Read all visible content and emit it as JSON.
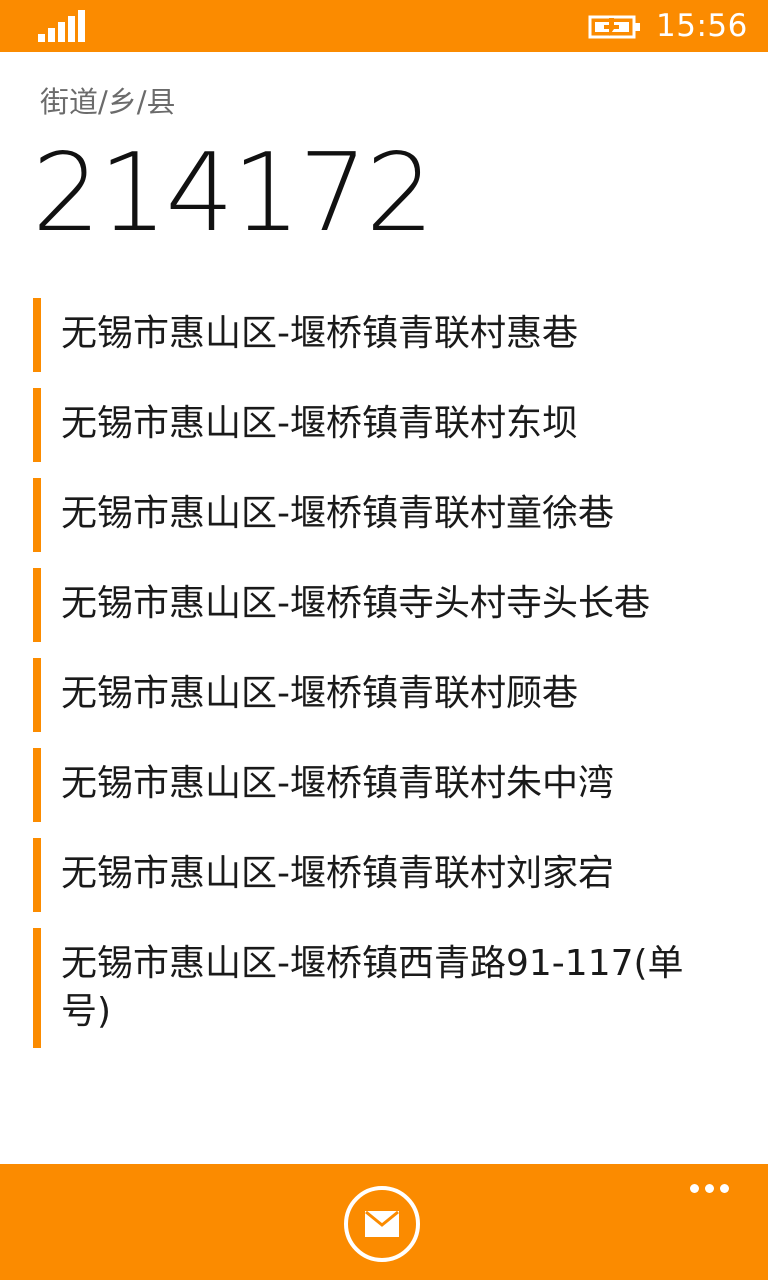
{
  "status_bar": {
    "time": "15:56",
    "signal_icon": "signal-bars-icon",
    "battery_icon": "battery-charging-icon"
  },
  "header": {
    "category": "街道/乡/县",
    "postcode": "214172"
  },
  "results": [
    {
      "label": "无锡市惠山区-堰桥镇青联村惠巷"
    },
    {
      "label": "无锡市惠山区-堰桥镇青联村东坝"
    },
    {
      "label": "无锡市惠山区-堰桥镇青联村童徐巷"
    },
    {
      "label": "无锡市惠山区-堰桥镇寺头村寺头长巷"
    },
    {
      "label": "无锡市惠山区-堰桥镇青联村顾巷"
    },
    {
      "label": "无锡市惠山区-堰桥镇青联村朱中湾"
    },
    {
      "label": "无锡市惠山区-堰桥镇青联村刘家宕"
    },
    {
      "label": "无锡市惠山区-堰桥镇西青路91-117(单号)"
    }
  ],
  "app_bar": {
    "primary_icon": "mail-icon",
    "more_icon": "more-ellipsis-icon"
  },
  "colors": {
    "accent": "#fb8b00",
    "background": "#ffffff",
    "text": "#1a1a1a",
    "subtle_text": "#6b6b6b"
  }
}
